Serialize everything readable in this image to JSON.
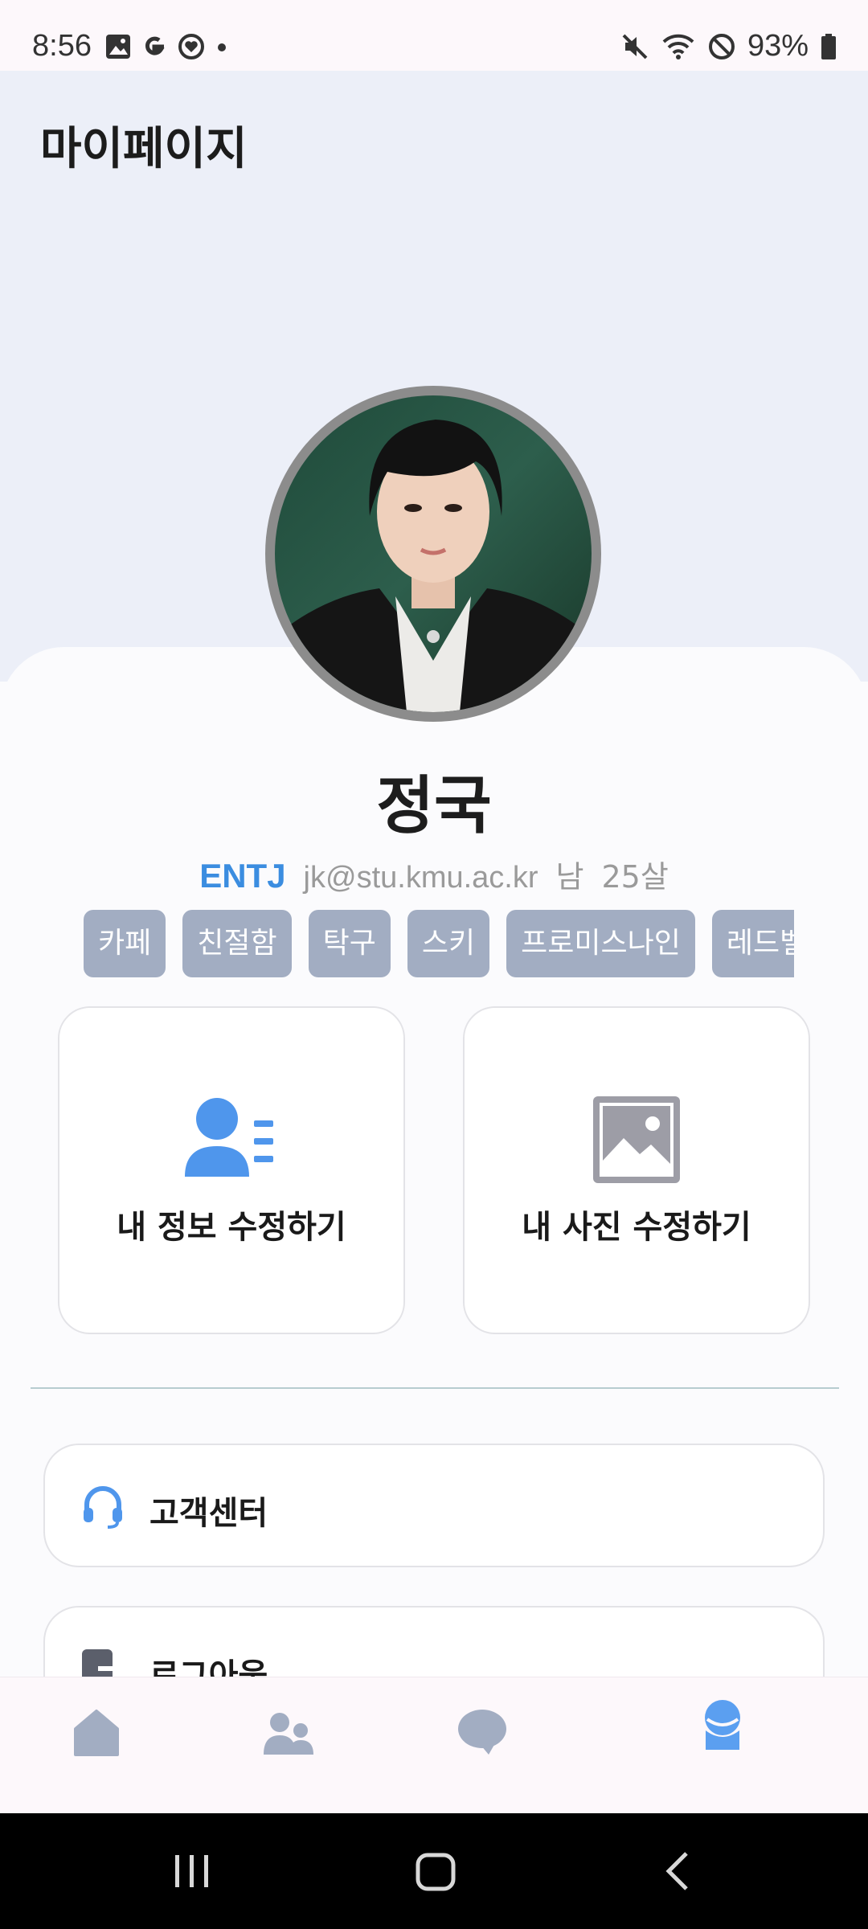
{
  "status_bar": {
    "time": "8:56",
    "battery": "93%",
    "left_icons": [
      "gallery-icon",
      "google-icon",
      "heart-badge-icon",
      "dot-icon"
    ],
    "right_icons": [
      "mute-icon",
      "wifi-icon",
      "do-not-disturb-icon",
      "battery-icon"
    ]
  },
  "header": {
    "title": "마이페이지"
  },
  "profile": {
    "name": "정국",
    "mbti": "ENTJ",
    "email": "jk@stu.kmu.ac.kr",
    "gender": "남",
    "age": "25살",
    "tags": [
      "카페",
      "친절함",
      "탁구",
      "스키",
      "프로미스나인",
      "레드벨"
    ]
  },
  "cards": {
    "edit_info": {
      "label": "내 정보 수정하기",
      "icon": "person-list-icon"
    },
    "edit_photo": {
      "label": "내 사진 수정하기",
      "icon": "image-icon"
    }
  },
  "menu": {
    "customer_center": {
      "label": "고객센터",
      "icon": "headset-icon"
    },
    "logout": {
      "label": "로그아웃",
      "icon": "logout-icon"
    }
  },
  "bottom_nav": [
    {
      "name": "home",
      "icon": "home-icon",
      "active": false
    },
    {
      "name": "friends",
      "icon": "people-icon",
      "active": false
    },
    {
      "name": "chat",
      "icon": "chat-bubble-icon",
      "active": false
    },
    {
      "name": "mypage",
      "icon": "character-icon",
      "active": true
    }
  ],
  "colors": {
    "accent": "#3b8de0",
    "tag_bg": "#a2adc2",
    "nav_inactive": "#a2adc2",
    "nav_active": "#5b9ff0",
    "header_bg": "#eceff8"
  }
}
